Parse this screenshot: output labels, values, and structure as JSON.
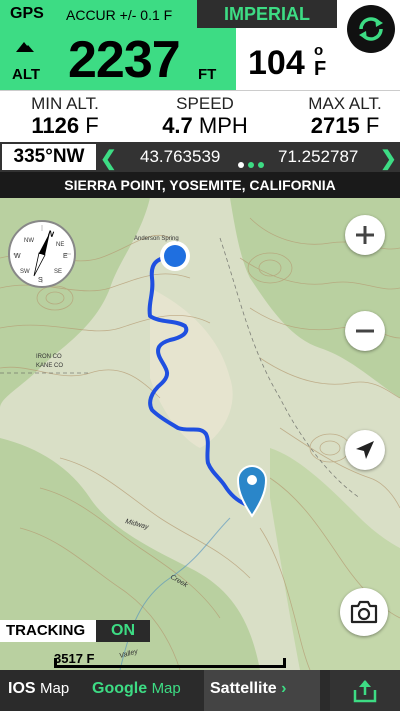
{
  "header": {
    "gps_label": "GPS",
    "accuracy": "ACCUR +/- 0.1 F",
    "unit_system": "IMPERIAL",
    "alt_label": "ALT",
    "altitude": "2237",
    "altitude_unit": "FT",
    "temperature": "104",
    "temperature_degree": "o",
    "temperature_unit": "F"
  },
  "stats": {
    "min_label": "MIN ALT.",
    "min_value": "1126",
    "min_unit": "F",
    "speed_label": "SPEED",
    "speed_value": "4.7",
    "speed_unit": "MPH",
    "max_label": "MAX ALT.",
    "max_value": "2715",
    "max_unit": "F"
  },
  "coords": {
    "heading": "335°NW",
    "latitude": "43.763539",
    "longitude": "71.252787",
    "page_count": 3,
    "active_page": 2
  },
  "location": "SIERRA POINT, YOSEMITE, CALIFORNIA",
  "map": {
    "compass_labels": [
      "N",
      "NE",
      "E",
      "SE",
      "S",
      "SW",
      "W",
      "NW"
    ],
    "labels": {
      "anderson": "Anderson Spring",
      "iron": "IRON CO",
      "kane": "KANE CO",
      "midway": "Midway",
      "creek": "Creek",
      "valley": "Valley"
    }
  },
  "tracking": {
    "label": "TRACKING",
    "value": "ON"
  },
  "scale": {
    "label": "3517 F"
  },
  "bottom": {
    "ios_bold": "IOS",
    "ios_light": "Map",
    "google_bold": "Google",
    "google_light": "Map",
    "satellite": "Sattellite",
    "satellite_chevron": "›"
  },
  "colors": {
    "accent": "#3ddc84",
    "route": "#1f4fe0"
  },
  "icons": {
    "refresh": "refresh-icon",
    "zoom_in": "plus-icon",
    "zoom_out": "minus-icon",
    "locate": "navigation-arrow-icon",
    "camera": "camera-icon",
    "share": "share-icon"
  }
}
